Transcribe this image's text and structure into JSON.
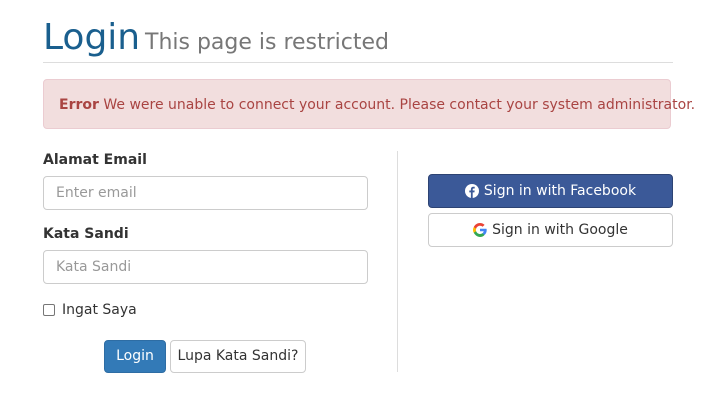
{
  "header": {
    "title": "Login",
    "subtitle": "This page is restricted"
  },
  "alert": {
    "strong": "Error",
    "message": " We were unable to connect your account. Please contact your system administrator."
  },
  "form": {
    "email_label": "Alamat Email",
    "email_placeholder": "Enter email",
    "email_value": "",
    "password_label": "Kata Sandi",
    "password_placeholder": "Kata Sandi",
    "password_value": "",
    "remember_label": "Ingat Saya",
    "remember_checked": false,
    "login_button": "Login",
    "forgot_button": "Lupa Kata Sandi?"
  },
  "social": {
    "facebook_label": "Sign in with Facebook",
    "facebook_icon": "facebook-icon",
    "google_label": "Sign in with Google",
    "google_icon": "google-icon"
  },
  "colors": {
    "title": "#1a5f8e",
    "alert_bg": "#f2dede",
    "alert_text": "#a94442",
    "primary": "#337ab7",
    "facebook": "#3b5998"
  }
}
